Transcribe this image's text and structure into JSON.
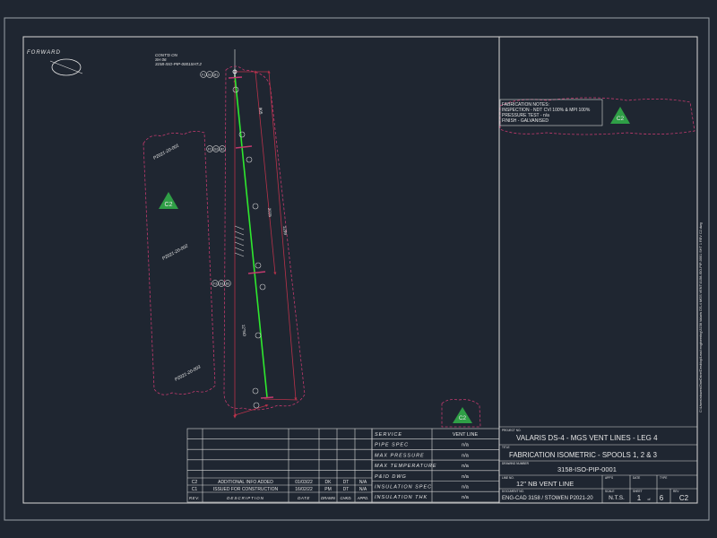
{
  "drawing": {
    "forward_label": "FORWARD",
    "continued_note": [
      "CONT'D ON",
      "SH 06",
      "3158-ISO-PIP-0001SHT.2"
    ],
    "spool_labels": [
      "P2021-20-001",
      "P2021-20-002",
      "P2021-20-003"
    ],
    "cloud_tag": "C2",
    "callouts": [
      "F1",
      "G1",
      "B1",
      "F2",
      "G2",
      "B2",
      "F3",
      "G3",
      "B3"
    ],
    "dim_labels": [
      "905",
      "2015",
      "12\"NO",
      "1299"
    ]
  },
  "fab_notes": {
    "title": "FABRICATION NOTES:",
    "lines": [
      "INSPECTION - NDT CVI 100% & MPI 100%",
      "PRESSURE TEST - n/a",
      "FINISH - GALVANISED"
    ],
    "tag": "C2"
  },
  "side_text": "C:\\Users\\stowen\\OneDrive\\Desktop\\Lead engineering\\3158 Valaris DS-4 MGS VENT\\3158-ISO-PIP-0001 SHT 1 REV C2.dwg",
  "revisions": {
    "header": {
      "rev": "REV.",
      "description": "DESCRIPTION",
      "date": "DATE",
      "drawn": "DRAWN",
      "chkd": "CHKD.",
      "appd": "APPD."
    },
    "rows": [
      {
        "rev": "C2",
        "description": "ADDITIONAL INFO ADDED",
        "date": "01/03/22",
        "drawn": "DK",
        "chkd": "DT",
        "appd": "N/A"
      },
      {
        "rev": "C1",
        "description": "ISSUED FOR CONSTRUCTION",
        "date": "16/02/22",
        "drawn": "PM",
        "chkd": "DT",
        "appd": "N/A"
      }
    ]
  },
  "service_table": [
    {
      "label": "SERVICE",
      "value": "VENT LINE"
    },
    {
      "label": "PIPE SPEC",
      "value": "n/a"
    },
    {
      "label": "MAX PRESSURE",
      "value": "n/a"
    },
    {
      "label": "MAX TEMPERATURE",
      "value": "n/a"
    },
    {
      "label": "P&ID DWG",
      "value": "n/a"
    },
    {
      "label": "INSULATION SPEC",
      "value": "n/a"
    },
    {
      "label": "INSULATION THK",
      "value": "n/a"
    }
  ],
  "service_tag": "C2",
  "title_block": {
    "project_label": "PROJECT NO.",
    "project": "VALARIS DS-4 - MGS VENT LINES - LEG 4",
    "title_label": "TITLE",
    "title": "FABRICATION ISOMETRIC - SPOOLS 1, 2 & 3",
    "drawing_no_label": "DRAWING NUMBER",
    "drawing_no": "3158-ISO-PIP-0001",
    "line_label": "LINE NO.",
    "line": "12\" NB VENT LINE",
    "apps_label": "APP'S",
    "date_label": "DATE",
    "type_label": "TYPE",
    "doc_label": "DOCUMENT NO.",
    "doc": "ENG-CAD 3158 / STOWEN P2021-20",
    "scale_label": "SCALE",
    "scale": "N.T.S.",
    "sheet_label": "SHEET",
    "sheet": "1",
    "of": "of",
    "total": "6",
    "rev_label": "REV",
    "rev": "C2"
  },
  "colors": {
    "background": "#1f2631",
    "border": "#cfcfcf",
    "pipe": "#2ee82e",
    "revcloud": "#c23a6e",
    "dimension": "#b8324a",
    "tag": "#2f9e46"
  }
}
